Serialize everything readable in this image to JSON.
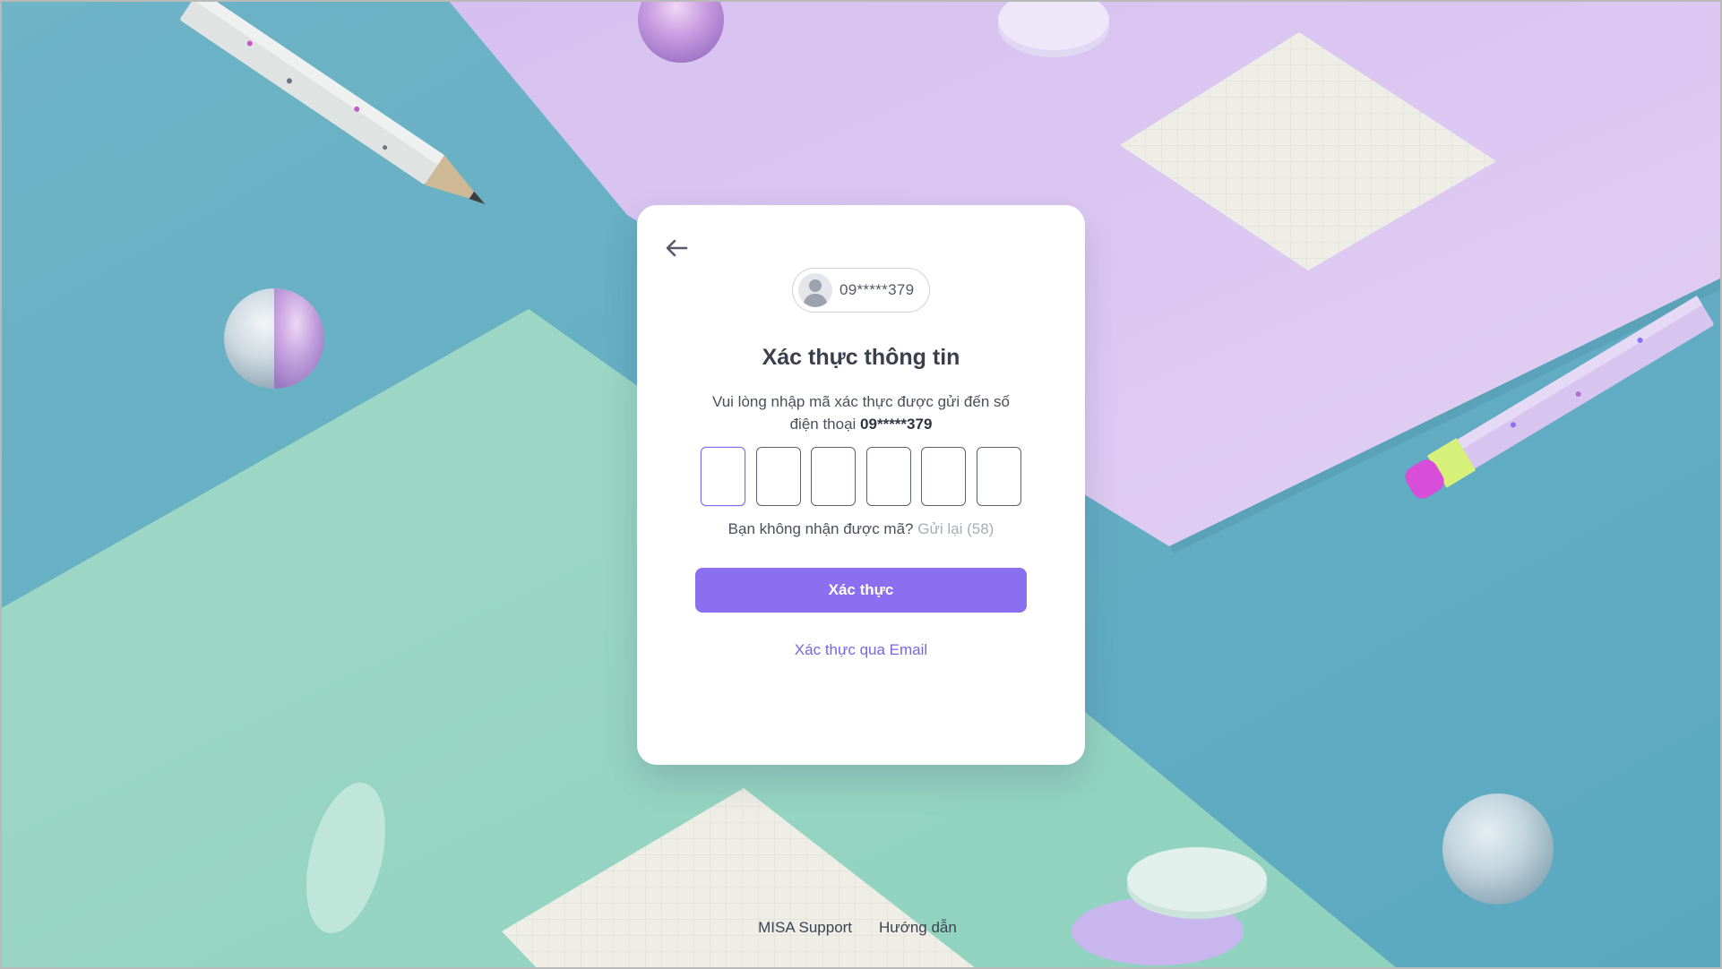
{
  "account": {
    "phone_masked": "09*****379"
  },
  "verify": {
    "title": "Xác thực thông tin",
    "description_prefix": "Vui lòng nhập mã xác thực được gửi đến số điện thoại ",
    "description_phone": "09*****379",
    "otp_length": 6,
    "otp_values": [
      "",
      "",
      "",
      "",
      "",
      ""
    ],
    "resend_prompt": "Bạn không nhận được mã?",
    "resend_label": "Gửi lại (58)",
    "submit_label": "Xác thực",
    "email_link_label": "Xác thực qua Email"
  },
  "footer": {
    "support_label": "MISA Support",
    "guide_label": "Hướng dẫn"
  },
  "colors": {
    "accent": "#8a6ff0",
    "link": "#7b63e6",
    "bg_teal": "#6fb6c9",
    "bg_lavender": "#d9c4ef",
    "bg_mint": "#a3d9c8"
  },
  "icons": [
    "back-arrow-icon",
    "user-avatar-icon"
  ]
}
